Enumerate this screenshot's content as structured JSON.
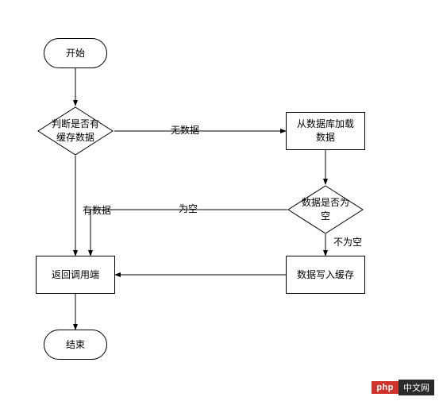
{
  "chart_data": {
    "type": "flowchart",
    "nodes": [
      {
        "id": "start",
        "kind": "terminator",
        "label": "开始"
      },
      {
        "id": "check_cache",
        "kind": "decision",
        "label": "判断是否有缓存数据"
      },
      {
        "id": "load_db",
        "kind": "process",
        "label": "从数据库加载数据"
      },
      {
        "id": "check_empty",
        "kind": "decision",
        "label": "数据是否为空"
      },
      {
        "id": "write_cache",
        "kind": "process",
        "label": "数据写入缓存"
      },
      {
        "id": "return",
        "kind": "process",
        "label": "返回调用端"
      },
      {
        "id": "end",
        "kind": "terminator",
        "label": "结束"
      }
    ],
    "edges": [
      {
        "from": "start",
        "to": "check_cache",
        "label": null
      },
      {
        "from": "check_cache",
        "to": "load_db",
        "label": "无数据"
      },
      {
        "from": "check_cache",
        "to": "return",
        "label": "有数据"
      },
      {
        "from": "load_db",
        "to": "check_empty",
        "label": null
      },
      {
        "from": "check_empty",
        "to": "return",
        "label": "为空"
      },
      {
        "from": "check_empty",
        "to": "write_cache",
        "label": "不为空"
      },
      {
        "from": "write_cache",
        "to": "return",
        "label": null
      },
      {
        "from": "return",
        "to": "end",
        "label": null
      }
    ]
  },
  "nodes": {
    "start": "开始",
    "check_cache": "判断是否有\n缓存数据",
    "load_db": "从数据库加载\n数据",
    "check_empty": "数据是否为\n空",
    "write_cache": "数据写入缓存",
    "return": "返回调用端",
    "end": "结束"
  },
  "edges": {
    "no_data": "无数据",
    "has_data": "有数据",
    "is_empty": "为空",
    "not_empty": "不为空"
  },
  "watermark": {
    "left": "php",
    "right": "中文网"
  }
}
